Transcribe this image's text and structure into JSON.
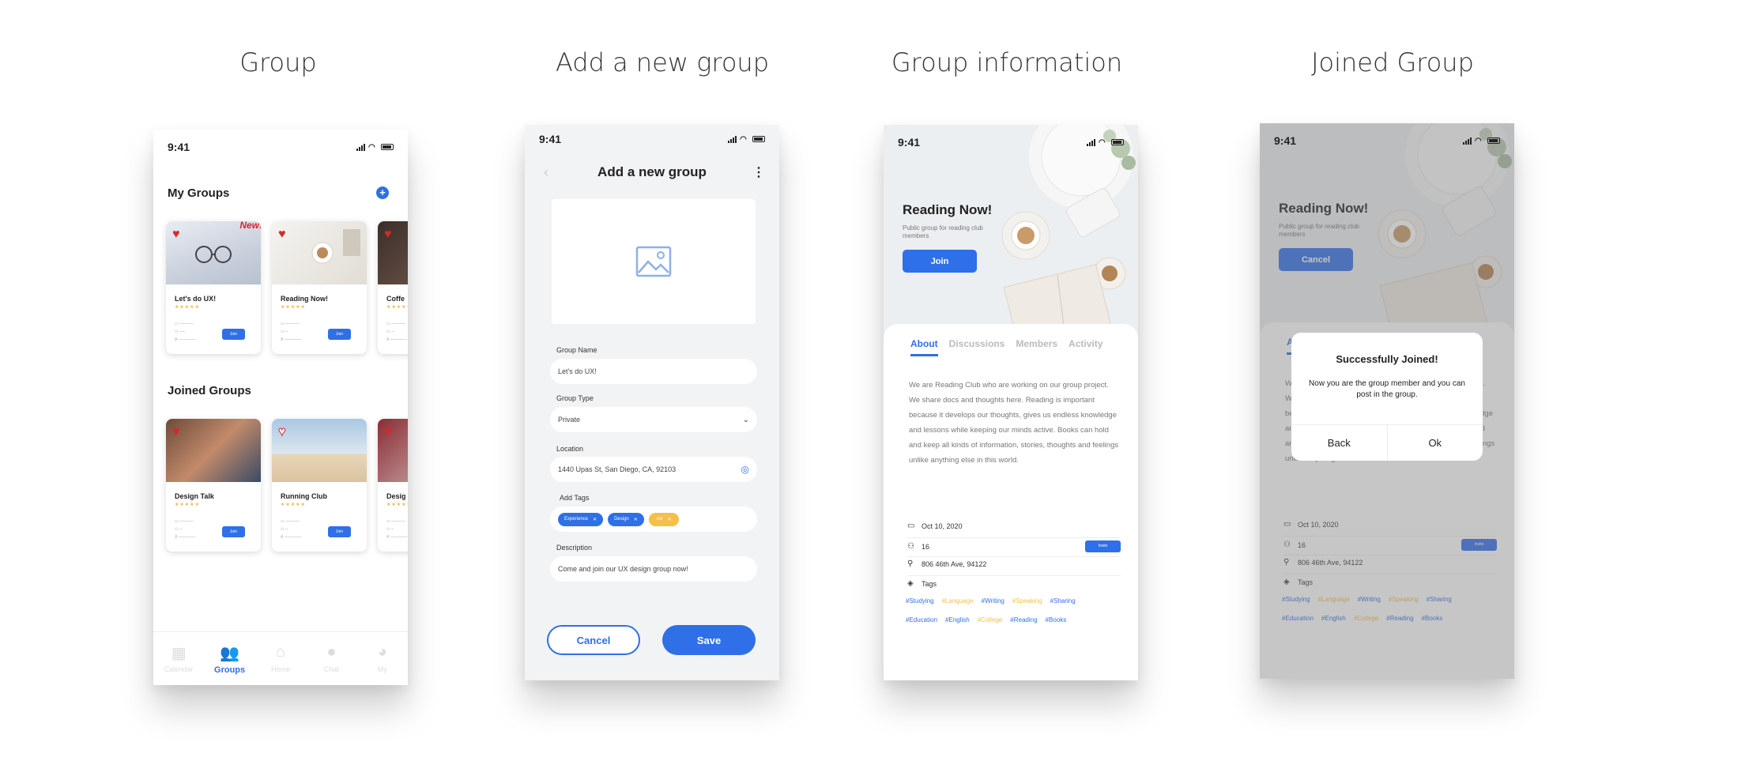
{
  "sections": [
    {
      "title": "Group"
    },
    {
      "title": "Add a new group"
    },
    {
      "title": "Group information"
    },
    {
      "title": "Joined Group"
    }
  ],
  "status": {
    "time": "9:41"
  },
  "group_screen": {
    "my_groups_title": "My Groups",
    "joined_groups_title": "Joined Groups",
    "new_badge": "New!",
    "join_label": "Join",
    "stars": "★★★★★",
    "my_groups": [
      {
        "name": "Let's do UX!"
      },
      {
        "name": "Reading Now!"
      },
      {
        "name": "Coffe"
      }
    ],
    "joined_groups": [
      {
        "name": "Design Talk"
      },
      {
        "name": "Running Club"
      },
      {
        "name": "Desig"
      }
    ],
    "tabs": [
      {
        "label": "Calendar",
        "icon": "calendar-icon"
      },
      {
        "label": "Groups",
        "icon": "groups-icon",
        "active": true
      },
      {
        "label": "Home",
        "icon": "home-icon"
      },
      {
        "label": "Chat",
        "icon": "chat-icon"
      },
      {
        "label": "My",
        "icon": "profile-icon"
      }
    ]
  },
  "add_group": {
    "title": "Add a new group",
    "group_name_label": "Group Name",
    "group_name_value": "Let's do UX!",
    "group_type_label": "Group Type",
    "group_type_value": "Private",
    "location_label": "Location",
    "location_value": "1440 Upas St, San Diego, CA, 92103",
    "tags_label": "Add Tags",
    "tags": [
      {
        "label": "Experience",
        "color": "#2f6fe8"
      },
      {
        "label": "Design",
        "color": "#2f6fe8"
      },
      {
        "label": "Art",
        "color": "#f4c04a"
      }
    ],
    "description_label": "Description",
    "description_value": "Come and join our UX design group now!",
    "cancel_label": "Cancel",
    "save_label": "Save"
  },
  "group_info": {
    "name": "Reading Now!",
    "subtitle": "Public group for reading club members",
    "join_label": "Join",
    "cancel_label": "Cancel",
    "tabs": [
      "About",
      "Discussions",
      "Members",
      "Activity"
    ],
    "about": "We are Reading Club who are working on our group project. We share docs and thoughts here. Reading is important because it develops our thoughts, gives us endless knowledge and lessons while keeping our minds active. Books can hold and keep all kinds of information, stories, thoughts and feelings unlike anything else in this world.",
    "date": "Oct 10, 2020",
    "members": "16",
    "invite_label": "Invite",
    "address": "806 46th Ave, 94122",
    "tags_label": "Tags",
    "tags_row1": [
      {
        "label": "#Studying",
        "color": "#2f6fe8"
      },
      {
        "label": "#Language",
        "color": "#f4c04a"
      },
      {
        "label": "#Writing",
        "color": "#2f6fe8"
      },
      {
        "label": "#Speaking",
        "color": "#f4c04a"
      },
      {
        "label": "#Sharing",
        "color": "#2f6fe8"
      }
    ],
    "tags_row2": [
      {
        "label": "#Education",
        "color": "#2f6fe8"
      },
      {
        "label": "#English",
        "color": "#2f6fe8"
      },
      {
        "label": "#College",
        "color": "#f4c04a"
      },
      {
        "label": "#Reading",
        "color": "#2f6fe8"
      },
      {
        "label": "#Books",
        "color": "#2f6fe8"
      }
    ]
  },
  "dialog": {
    "title": "Successfully Joined!",
    "message": "Now you are the group member and you can post in the group.",
    "back_label": "Back",
    "ok_label": "Ok"
  },
  "colors": {
    "accent": "#2f6fe8",
    "heart": "#d62828",
    "star": "#f2b53c"
  }
}
